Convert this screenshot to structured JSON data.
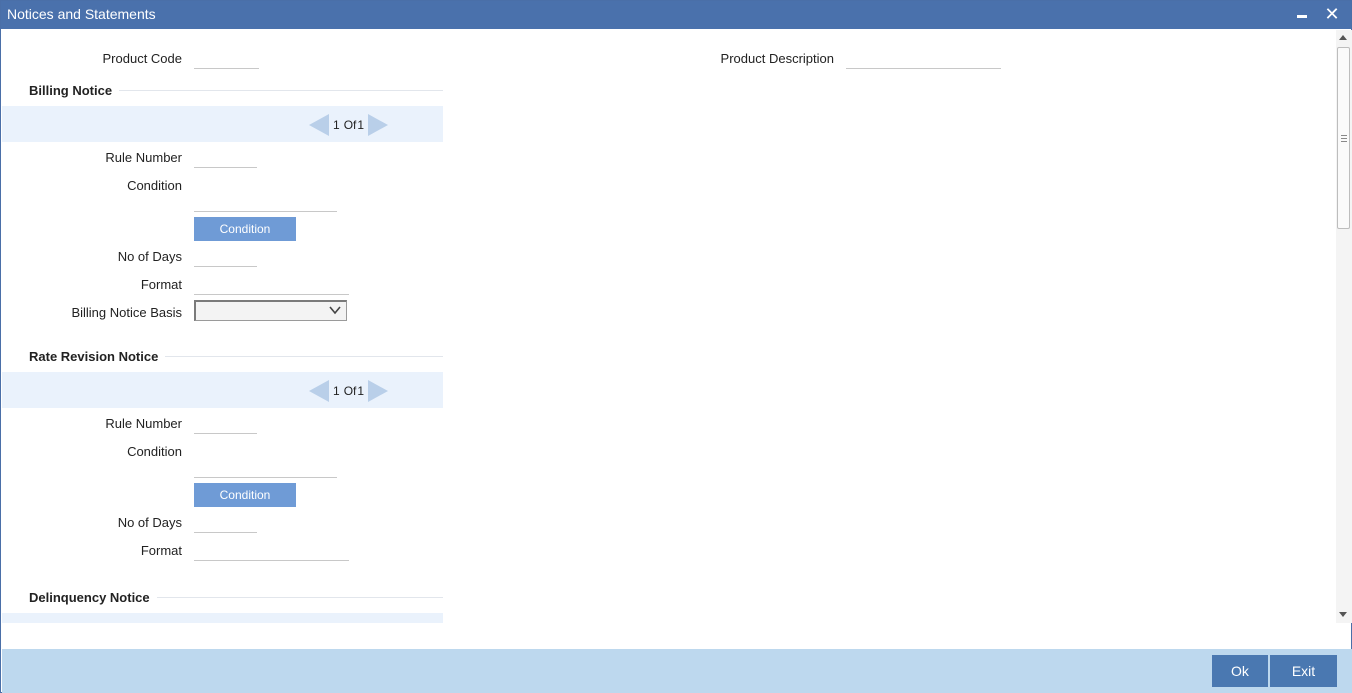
{
  "window": {
    "title": "Notices and Statements"
  },
  "header": {
    "product_code_label": "Product Code",
    "product_code_value": "",
    "product_description_label": "Product Description",
    "product_description_value": ""
  },
  "billing_notice": {
    "title": "Billing Notice",
    "pager": {
      "current": "1",
      "of_text": "Of",
      "total": "1"
    },
    "rule_number_label": "Rule Number",
    "rule_number_value": "",
    "condition_label": "Condition",
    "condition_value": "",
    "condition_button": "Condition",
    "no_of_days_label": "No of Days",
    "no_of_days_value": "",
    "format_label": "Format",
    "format_value": "",
    "billing_notice_basis_label": "Billing Notice Basis",
    "billing_notice_basis_value": ""
  },
  "rate_revision_notice": {
    "title": "Rate Revision Notice",
    "pager": {
      "current": "1",
      "of_text": "Of",
      "total": "1"
    },
    "rule_number_label": "Rule Number",
    "rule_number_value": "",
    "condition_label": "Condition",
    "condition_value": "",
    "condition_button": "Condition",
    "no_of_days_label": "No of Days",
    "no_of_days_value": "",
    "format_label": "Format",
    "format_value": ""
  },
  "delinquency_notice": {
    "title": "Delinquency Notice"
  },
  "footer": {
    "ok_label": "Ok",
    "exit_label": "Exit"
  },
  "colors": {
    "titlebar": "#4a71ac",
    "footer": "#bdd8ee",
    "button": "#4a78b1",
    "condition_button": "#6f9bd6",
    "pager_bar": "#eaf2fc"
  }
}
